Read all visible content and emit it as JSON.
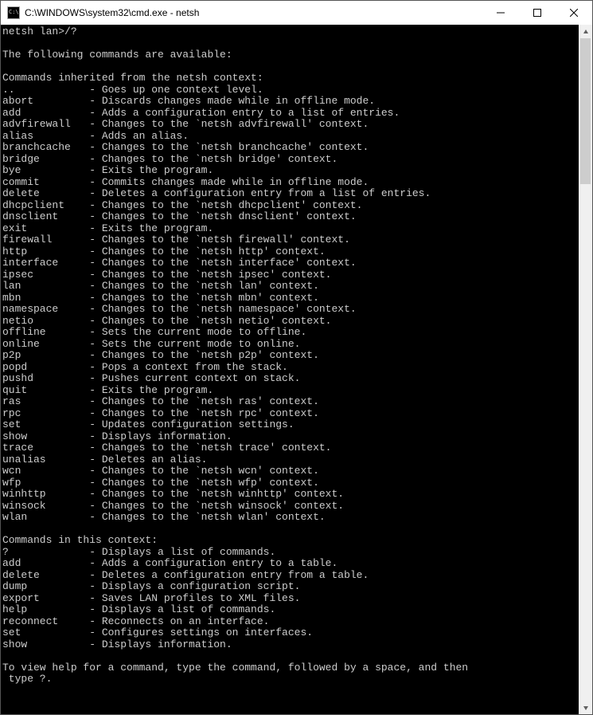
{
  "window": {
    "title": "C:\\WINDOWS\\system32\\cmd.exe - netsh"
  },
  "terminal": {
    "prompt": "netsh lan>/?",
    "intro": "The following commands are available:",
    "section1_header": "Commands inherited from the netsh context:",
    "inherited": [
      {
        "name": "..",
        "desc": "Goes up one context level."
      },
      {
        "name": "abort",
        "desc": "Discards changes made while in offline mode."
      },
      {
        "name": "add",
        "desc": "Adds a configuration entry to a list of entries."
      },
      {
        "name": "advfirewall",
        "desc": "Changes to the `netsh advfirewall' context."
      },
      {
        "name": "alias",
        "desc": "Adds an alias."
      },
      {
        "name": "branchcache",
        "desc": "Changes to the `netsh branchcache' context."
      },
      {
        "name": "bridge",
        "desc": "Changes to the `netsh bridge' context."
      },
      {
        "name": "bye",
        "desc": "Exits the program."
      },
      {
        "name": "commit",
        "desc": "Commits changes made while in offline mode."
      },
      {
        "name": "delete",
        "desc": "Deletes a configuration entry from a list of entries."
      },
      {
        "name": "dhcpclient",
        "desc": "Changes to the `netsh dhcpclient' context."
      },
      {
        "name": "dnsclient",
        "desc": "Changes to the `netsh dnsclient' context."
      },
      {
        "name": "exit",
        "desc": "Exits the program."
      },
      {
        "name": "firewall",
        "desc": "Changes to the `netsh firewall' context."
      },
      {
        "name": "http",
        "desc": "Changes to the `netsh http' context."
      },
      {
        "name": "interface",
        "desc": "Changes to the `netsh interface' context."
      },
      {
        "name": "ipsec",
        "desc": "Changes to the `netsh ipsec' context."
      },
      {
        "name": "lan",
        "desc": "Changes to the `netsh lan' context."
      },
      {
        "name": "mbn",
        "desc": "Changes to the `netsh mbn' context."
      },
      {
        "name": "namespace",
        "desc": "Changes to the `netsh namespace' context."
      },
      {
        "name": "netio",
        "desc": "Changes to the `netsh netio' context."
      },
      {
        "name": "offline",
        "desc": "Sets the current mode to offline."
      },
      {
        "name": "online",
        "desc": "Sets the current mode to online."
      },
      {
        "name": "p2p",
        "desc": "Changes to the `netsh p2p' context."
      },
      {
        "name": "popd",
        "desc": "Pops a context from the stack."
      },
      {
        "name": "pushd",
        "desc": "Pushes current context on stack."
      },
      {
        "name": "quit",
        "desc": "Exits the program."
      },
      {
        "name": "ras",
        "desc": "Changes to the `netsh ras' context."
      },
      {
        "name": "rpc",
        "desc": "Changes to the `netsh rpc' context."
      },
      {
        "name": "set",
        "desc": "Updates configuration settings."
      },
      {
        "name": "show",
        "desc": "Displays information."
      },
      {
        "name": "trace",
        "desc": "Changes to the `netsh trace' context."
      },
      {
        "name": "unalias",
        "desc": "Deletes an alias."
      },
      {
        "name": "wcn",
        "desc": "Changes to the `netsh wcn' context."
      },
      {
        "name": "wfp",
        "desc": "Changes to the `netsh wfp' context."
      },
      {
        "name": "winhttp",
        "desc": "Changes to the `netsh winhttp' context."
      },
      {
        "name": "winsock",
        "desc": "Changes to the `netsh winsock' context."
      },
      {
        "name": "wlan",
        "desc": "Changes to the `netsh wlan' context."
      }
    ],
    "section2_header": "Commands in this context:",
    "context": [
      {
        "name": "?",
        "desc": "Displays a list of commands."
      },
      {
        "name": "add",
        "desc": "Adds a configuration entry to a table."
      },
      {
        "name": "delete",
        "desc": "Deletes a configuration entry from a table."
      },
      {
        "name": "dump",
        "desc": "Displays a configuration script."
      },
      {
        "name": "export",
        "desc": "Saves LAN profiles to XML files."
      },
      {
        "name": "help",
        "desc": "Displays a list of commands."
      },
      {
        "name": "reconnect",
        "desc": "Reconnects on an interface."
      },
      {
        "name": "set",
        "desc": "Configures settings on interfaces."
      },
      {
        "name": "show",
        "desc": "Displays information."
      }
    ],
    "footer1": "To view help for a command, type the command, followed by a space, and then",
    "footer2": " type ?."
  },
  "scrollbar": {
    "thumb_top_pct": 0,
    "thumb_height_pct": 22
  }
}
